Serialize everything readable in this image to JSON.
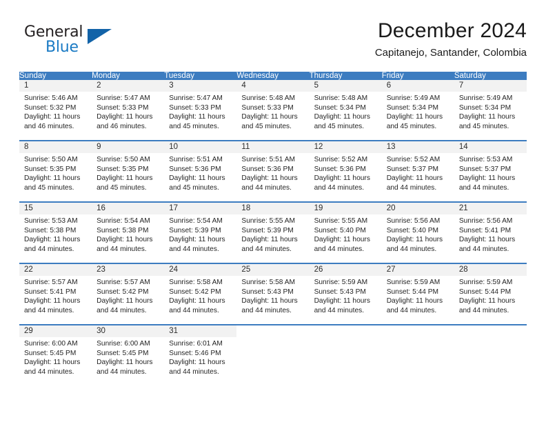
{
  "brand": {
    "word1": "General",
    "word2": "Blue",
    "triangle_color": "#1263a8",
    "blue_text_color": "#1a7ac4"
  },
  "header": {
    "title": "December 2024",
    "subtitle": "Capitanejo, Santander, Colombia"
  },
  "theme": {
    "header_bar_color": "#3c7cc0",
    "daynum_band_color": "#f2f2f2",
    "row_rule_color": "#3c7cc0"
  },
  "day_headers": [
    "Sunday",
    "Monday",
    "Tuesday",
    "Wednesday",
    "Thursday",
    "Friday",
    "Saturday"
  ],
  "weeks": [
    [
      {
        "day": "1",
        "sunrise": "Sunrise: 5:46 AM",
        "sunset": "Sunset: 5:32 PM",
        "daylight1": "Daylight: 11 hours",
        "daylight2": "and 46 minutes."
      },
      {
        "day": "2",
        "sunrise": "Sunrise: 5:47 AM",
        "sunset": "Sunset: 5:33 PM",
        "daylight1": "Daylight: 11 hours",
        "daylight2": "and 46 minutes."
      },
      {
        "day": "3",
        "sunrise": "Sunrise: 5:47 AM",
        "sunset": "Sunset: 5:33 PM",
        "daylight1": "Daylight: 11 hours",
        "daylight2": "and 45 minutes."
      },
      {
        "day": "4",
        "sunrise": "Sunrise: 5:48 AM",
        "sunset": "Sunset: 5:33 PM",
        "daylight1": "Daylight: 11 hours",
        "daylight2": "and 45 minutes."
      },
      {
        "day": "5",
        "sunrise": "Sunrise: 5:48 AM",
        "sunset": "Sunset: 5:34 PM",
        "daylight1": "Daylight: 11 hours",
        "daylight2": "and 45 minutes."
      },
      {
        "day": "6",
        "sunrise": "Sunrise: 5:49 AM",
        "sunset": "Sunset: 5:34 PM",
        "daylight1": "Daylight: 11 hours",
        "daylight2": "and 45 minutes."
      },
      {
        "day": "7",
        "sunrise": "Sunrise: 5:49 AM",
        "sunset": "Sunset: 5:34 PM",
        "daylight1": "Daylight: 11 hours",
        "daylight2": "and 45 minutes."
      }
    ],
    [
      {
        "day": "8",
        "sunrise": "Sunrise: 5:50 AM",
        "sunset": "Sunset: 5:35 PM",
        "daylight1": "Daylight: 11 hours",
        "daylight2": "and 45 minutes."
      },
      {
        "day": "9",
        "sunrise": "Sunrise: 5:50 AM",
        "sunset": "Sunset: 5:35 PM",
        "daylight1": "Daylight: 11 hours",
        "daylight2": "and 45 minutes."
      },
      {
        "day": "10",
        "sunrise": "Sunrise: 5:51 AM",
        "sunset": "Sunset: 5:36 PM",
        "daylight1": "Daylight: 11 hours",
        "daylight2": "and 45 minutes."
      },
      {
        "day": "11",
        "sunrise": "Sunrise: 5:51 AM",
        "sunset": "Sunset: 5:36 PM",
        "daylight1": "Daylight: 11 hours",
        "daylight2": "and 44 minutes."
      },
      {
        "day": "12",
        "sunrise": "Sunrise: 5:52 AM",
        "sunset": "Sunset: 5:36 PM",
        "daylight1": "Daylight: 11 hours",
        "daylight2": "and 44 minutes."
      },
      {
        "day": "13",
        "sunrise": "Sunrise: 5:52 AM",
        "sunset": "Sunset: 5:37 PM",
        "daylight1": "Daylight: 11 hours",
        "daylight2": "and 44 minutes."
      },
      {
        "day": "14",
        "sunrise": "Sunrise: 5:53 AM",
        "sunset": "Sunset: 5:37 PM",
        "daylight1": "Daylight: 11 hours",
        "daylight2": "and 44 minutes."
      }
    ],
    [
      {
        "day": "15",
        "sunrise": "Sunrise: 5:53 AM",
        "sunset": "Sunset: 5:38 PM",
        "daylight1": "Daylight: 11 hours",
        "daylight2": "and 44 minutes."
      },
      {
        "day": "16",
        "sunrise": "Sunrise: 5:54 AM",
        "sunset": "Sunset: 5:38 PM",
        "daylight1": "Daylight: 11 hours",
        "daylight2": "and 44 minutes."
      },
      {
        "day": "17",
        "sunrise": "Sunrise: 5:54 AM",
        "sunset": "Sunset: 5:39 PM",
        "daylight1": "Daylight: 11 hours",
        "daylight2": "and 44 minutes."
      },
      {
        "day": "18",
        "sunrise": "Sunrise: 5:55 AM",
        "sunset": "Sunset: 5:39 PM",
        "daylight1": "Daylight: 11 hours",
        "daylight2": "and 44 minutes."
      },
      {
        "day": "19",
        "sunrise": "Sunrise: 5:55 AM",
        "sunset": "Sunset: 5:40 PM",
        "daylight1": "Daylight: 11 hours",
        "daylight2": "and 44 minutes."
      },
      {
        "day": "20",
        "sunrise": "Sunrise: 5:56 AM",
        "sunset": "Sunset: 5:40 PM",
        "daylight1": "Daylight: 11 hours",
        "daylight2": "and 44 minutes."
      },
      {
        "day": "21",
        "sunrise": "Sunrise: 5:56 AM",
        "sunset": "Sunset: 5:41 PM",
        "daylight1": "Daylight: 11 hours",
        "daylight2": "and 44 minutes."
      }
    ],
    [
      {
        "day": "22",
        "sunrise": "Sunrise: 5:57 AM",
        "sunset": "Sunset: 5:41 PM",
        "daylight1": "Daylight: 11 hours",
        "daylight2": "and 44 minutes."
      },
      {
        "day": "23",
        "sunrise": "Sunrise: 5:57 AM",
        "sunset": "Sunset: 5:42 PM",
        "daylight1": "Daylight: 11 hours",
        "daylight2": "and 44 minutes."
      },
      {
        "day": "24",
        "sunrise": "Sunrise: 5:58 AM",
        "sunset": "Sunset: 5:42 PM",
        "daylight1": "Daylight: 11 hours",
        "daylight2": "and 44 minutes."
      },
      {
        "day": "25",
        "sunrise": "Sunrise: 5:58 AM",
        "sunset": "Sunset: 5:43 PM",
        "daylight1": "Daylight: 11 hours",
        "daylight2": "and 44 minutes."
      },
      {
        "day": "26",
        "sunrise": "Sunrise: 5:59 AM",
        "sunset": "Sunset: 5:43 PM",
        "daylight1": "Daylight: 11 hours",
        "daylight2": "and 44 minutes."
      },
      {
        "day": "27",
        "sunrise": "Sunrise: 5:59 AM",
        "sunset": "Sunset: 5:44 PM",
        "daylight1": "Daylight: 11 hours",
        "daylight2": "and 44 minutes."
      },
      {
        "day": "28",
        "sunrise": "Sunrise: 5:59 AM",
        "sunset": "Sunset: 5:44 PM",
        "daylight1": "Daylight: 11 hours",
        "daylight2": "and 44 minutes."
      }
    ],
    [
      {
        "day": "29",
        "sunrise": "Sunrise: 6:00 AM",
        "sunset": "Sunset: 5:45 PM",
        "daylight1": "Daylight: 11 hours",
        "daylight2": "and 44 minutes."
      },
      {
        "day": "30",
        "sunrise": "Sunrise: 6:00 AM",
        "sunset": "Sunset: 5:45 PM",
        "daylight1": "Daylight: 11 hours",
        "daylight2": "and 44 minutes."
      },
      {
        "day": "31",
        "sunrise": "Sunrise: 6:01 AM",
        "sunset": "Sunset: 5:46 PM",
        "daylight1": "Daylight: 11 hours",
        "daylight2": "and 44 minutes."
      },
      {
        "day": "",
        "sunrise": "",
        "sunset": "",
        "daylight1": "",
        "daylight2": ""
      },
      {
        "day": "",
        "sunrise": "",
        "sunset": "",
        "daylight1": "",
        "daylight2": ""
      },
      {
        "day": "",
        "sunrise": "",
        "sunset": "",
        "daylight1": "",
        "daylight2": ""
      },
      {
        "day": "",
        "sunrise": "",
        "sunset": "",
        "daylight1": "",
        "daylight2": ""
      }
    ]
  ]
}
